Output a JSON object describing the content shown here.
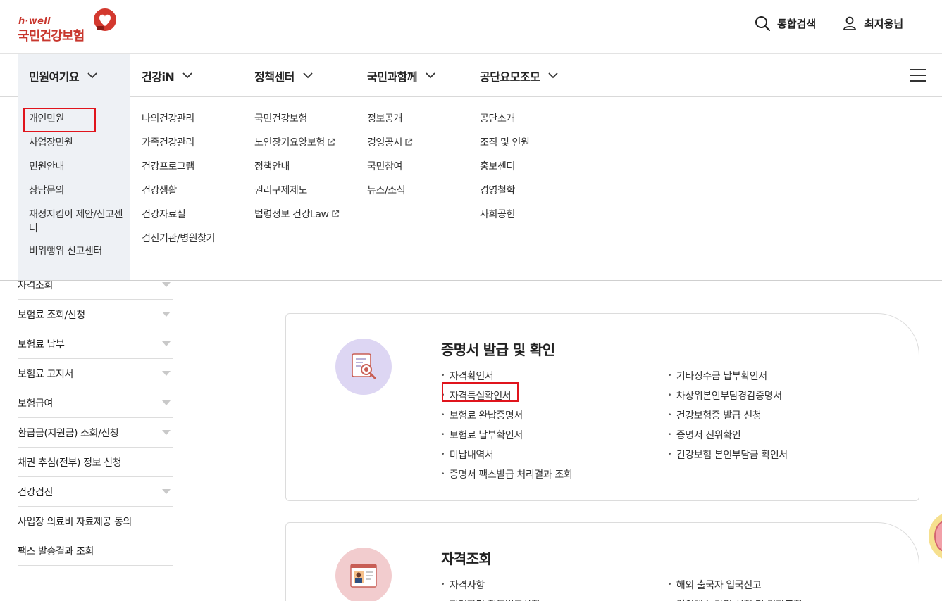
{
  "header": {
    "logo_sub": "h·well",
    "logo_main": "국민건강보험",
    "search_label": "통합검색",
    "user_label": "최지웅님"
  },
  "nav": {
    "items": [
      {
        "label": "민원여기요"
      },
      {
        "label": "건강iN"
      },
      {
        "label": "정책센터"
      },
      {
        "label": "국민과함께"
      },
      {
        "label": "공단요모조모"
      }
    ]
  },
  "mega_menu": {
    "col1": [
      "개인민원",
      "사업장민원",
      "민원안내",
      "상담문의",
      "재정지킴이 제안/신고센터",
      "비위행위 신고센터"
    ],
    "col2": [
      "나의건강관리",
      "가족건강관리",
      "건강프로그램",
      "건강생활",
      "건강자료실",
      "검진기관/병원찾기"
    ],
    "col3": [
      "국민건강보험",
      "노인장기요양보험",
      "정책안내",
      "권리구제제도",
      "법령정보 건강Law"
    ],
    "col4": [
      "정보공개",
      "경영공시",
      "국민참여",
      "뉴스/소식"
    ],
    "col5": [
      "공단소개",
      "조직 및 인원",
      "홍보센터",
      "경영철학",
      "사회공헌"
    ]
  },
  "side_menu": [
    {
      "label": "자격조회",
      "expandable": true
    },
    {
      "label": "보험료 조회/신청",
      "expandable": true
    },
    {
      "label": "보험료 납부",
      "expandable": true
    },
    {
      "label": "보험료 고지서",
      "expandable": true
    },
    {
      "label": "보험급여",
      "expandable": true
    },
    {
      "label": "환급금(지원금) 조회/신청",
      "expandable": true
    },
    {
      "label": "채권 추심(전부) 정보 신청",
      "expandable": false
    },
    {
      "label": "건강검진",
      "expandable": true
    },
    {
      "label": "사업장 의료비 자료제공 동의",
      "expandable": false
    },
    {
      "label": "팩스 발송결과 조회",
      "expandable": false
    }
  ],
  "cards": [
    {
      "title": "증명서 발급 및 확인",
      "left_links": [
        "자격확인서",
        "자격득실확인서",
        "보험료 완납증명서",
        "보험료 납부확인서",
        "미납내역서",
        "증명서 팩스발급 처리결과 조회"
      ],
      "right_links": [
        "기타징수금 납부확인서",
        "차상위본인부담경감증명서",
        "건강보험증 발급 신청",
        "증명서 진위확인",
        "건강보험 본인부담금 확인서"
      ]
    },
    {
      "title": "자격조회",
      "left_links": [
        "자격사항",
        "지역자격 취득변동사항"
      ],
      "right_links": [
        "해외 출국자 입국신고",
        "임의계속 가입 신청 및 결과조회"
      ]
    }
  ],
  "colors": {
    "brand_red": "#c8362d",
    "highlight_red": "#e0141c",
    "nav_active_bg": "#eef1f5",
    "card1_icon_bg": "#ddd6f3",
    "card2_icon_bg": "#f2ccce"
  }
}
